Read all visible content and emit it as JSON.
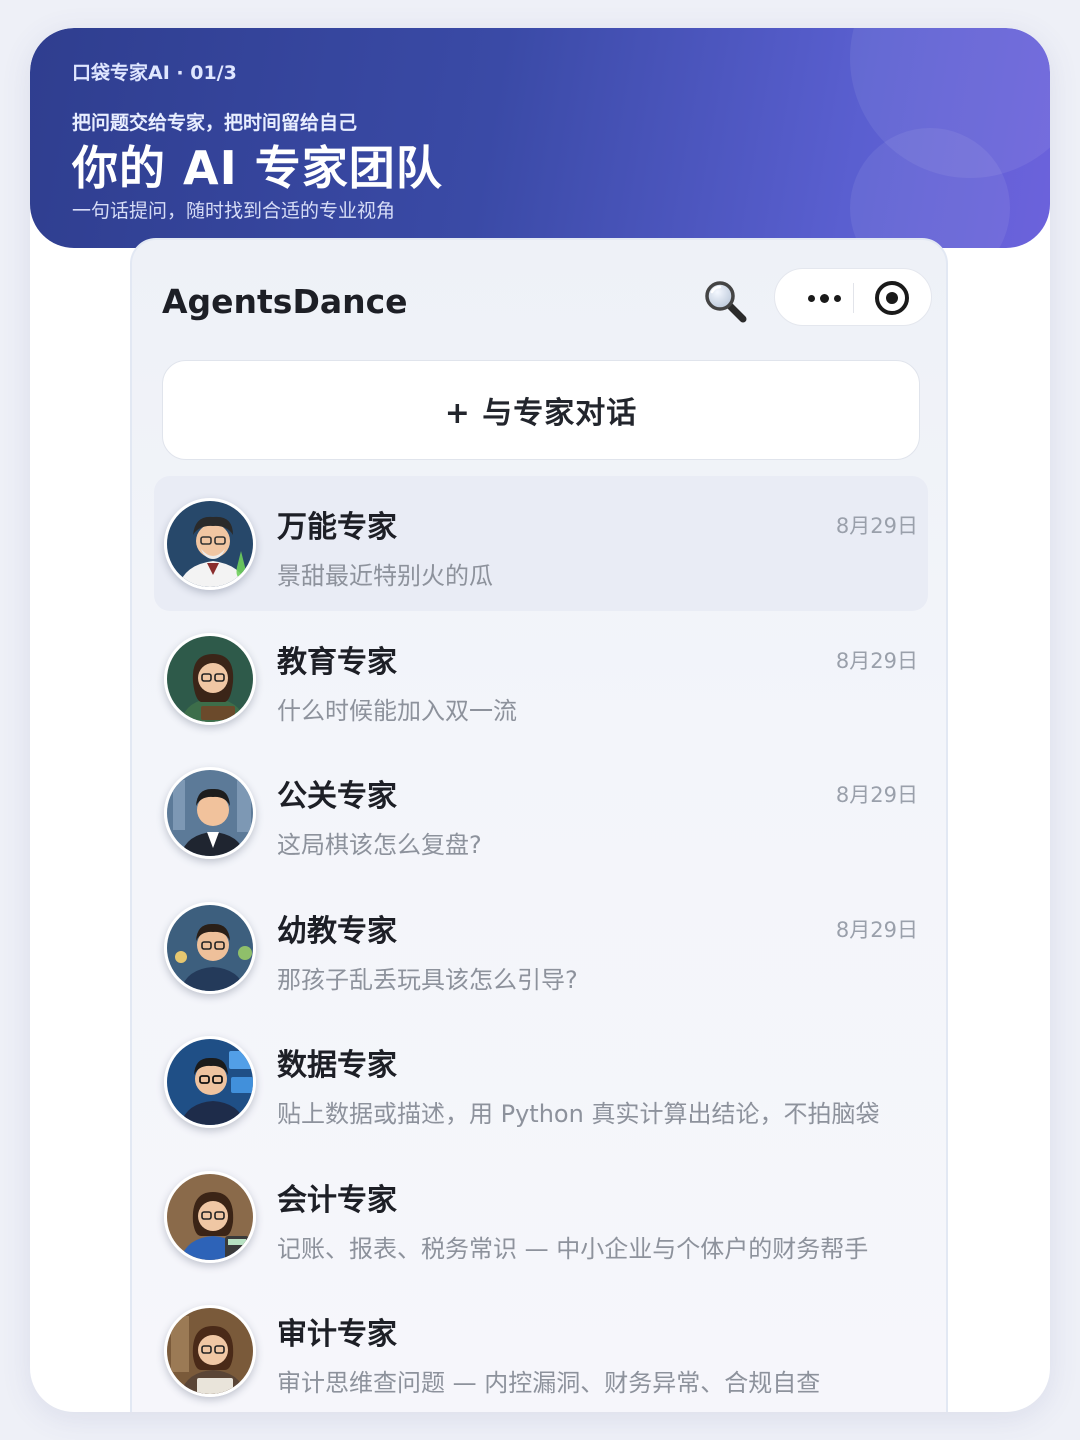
{
  "banner": {
    "kicker": "口袋专家AI · 01/3",
    "tagline": "把问题交给专家，把时间留给自己",
    "headline": "你的 AI 专家团队",
    "subtitle": "一句话提问，随时找到合适的专业视角"
  },
  "app": {
    "title": "AgentsDance",
    "new_chat_label": "+ 与专家对话",
    "icons": {
      "search": "search-icon",
      "more": "more-dots-icon",
      "close": "mini-program-close-icon"
    }
  },
  "conversations": [
    {
      "name": "万能专家",
      "date": "8月29日",
      "preview": "景甜最近特别火的瓜",
      "active": true
    },
    {
      "name": "教育专家",
      "date": "8月29日",
      "preview": "什么时候能加入双一流"
    },
    {
      "name": "公关专家",
      "date": "8月29日",
      "preview": "这局棋该怎么复盘?"
    },
    {
      "name": "幼教专家",
      "date": "8月29日",
      "preview": "那孩子乱丢玩具该怎么引导?"
    },
    {
      "name": "数据专家",
      "date": "",
      "preview": "贴上数据或描述，用 Python 真实计算出结论，不拍脑袋"
    },
    {
      "name": "会计专家",
      "date": "",
      "preview": "记账、报表、税务常识 — 中小企业与个体户的财务帮手"
    },
    {
      "name": "审计专家",
      "date": "",
      "preview": "审计思维查问题 — 内控漏洞、财务异常、合规自查"
    }
  ],
  "colors": {
    "banner_start": "#2f3e8f",
    "banner_end": "#6c62dc",
    "active_row": "#e9ecf5",
    "muted_text": "#8d929c"
  }
}
